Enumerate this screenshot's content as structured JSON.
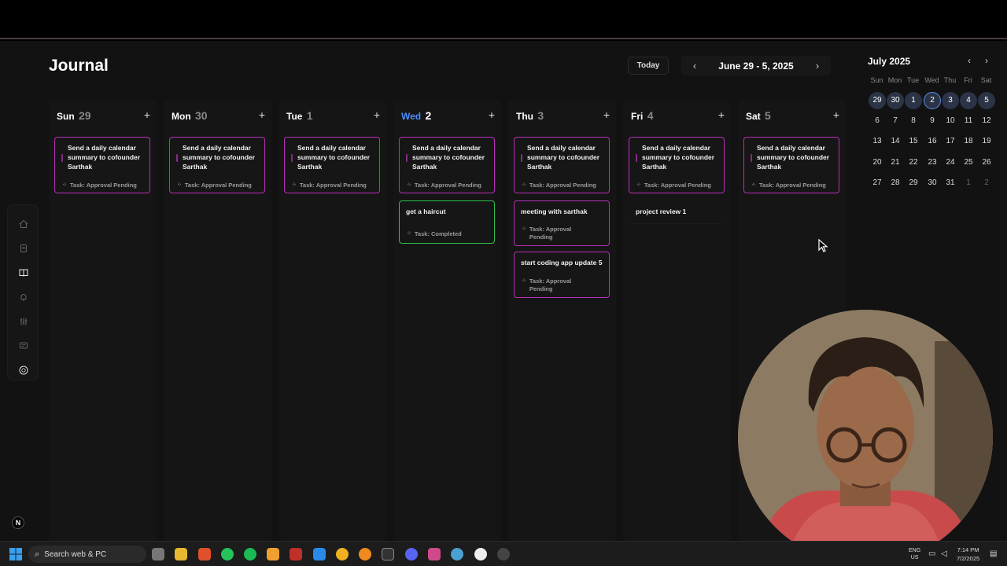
{
  "header": {
    "title": "Journal",
    "today_label": "Today",
    "prev_icon": "chevron-left-icon",
    "next_icon": "chevron-right-icon",
    "range_label": "June 29 - 5, 2025"
  },
  "sidebar": {
    "items": [
      {
        "icon": "home-icon"
      },
      {
        "icon": "document-icon"
      },
      {
        "icon": "book-icon"
      },
      {
        "icon": "bell-icon"
      },
      {
        "icon": "sliders-icon"
      },
      {
        "icon": "chat-icon"
      },
      {
        "icon": "profile-icon"
      }
    ]
  },
  "week": {
    "add_label": "+",
    "days": [
      {
        "name": "Sun",
        "num": "29"
      },
      {
        "name": "Mon",
        "num": "30"
      },
      {
        "name": "Tue",
        "num": "1"
      },
      {
        "name": "Wed",
        "num": "2"
      },
      {
        "name": "Thu",
        "num": "3"
      },
      {
        "name": "Fri",
        "num": "4"
      },
      {
        "name": "Sat",
        "num": "5"
      }
    ]
  },
  "cards": {
    "recurring_title": "Send a daily calendar summary to cofounder Sarthak",
    "pending": "Task: Approval Pending",
    "completed": "Task: Completed",
    "haircut": "get a haircut",
    "meeting": "meeting with sarthak",
    "coding": "start coding app update 5",
    "review": "project review 1"
  },
  "mini_calendar": {
    "month": "July 2025",
    "dow": [
      "Sun",
      "Mon",
      "Tue",
      "Wed",
      "Thu",
      "Fri",
      "Sat"
    ],
    "rows": [
      [
        "29",
        "30",
        "1",
        "2",
        "3",
        "4",
        "5"
      ],
      [
        "6",
        "7",
        "8",
        "9",
        "10",
        "11",
        "12"
      ],
      [
        "13",
        "14",
        "15",
        "16",
        "17",
        "18",
        "19"
      ],
      [
        "20",
        "21",
        "22",
        "23",
        "24",
        "25",
        "26"
      ],
      [
        "27",
        "28",
        "29",
        "30",
        "31",
        "1",
        "2"
      ]
    ]
  },
  "taskbar": {
    "search_placeholder": "Search web & PC",
    "time": "7:14 PM",
    "date": "7/2/2025",
    "lang": "ENG",
    "region": "US"
  },
  "colors": {
    "accent_today": "#4c8dff",
    "pending_border": "#b82fb8",
    "completed_border": "#2ec24c"
  }
}
